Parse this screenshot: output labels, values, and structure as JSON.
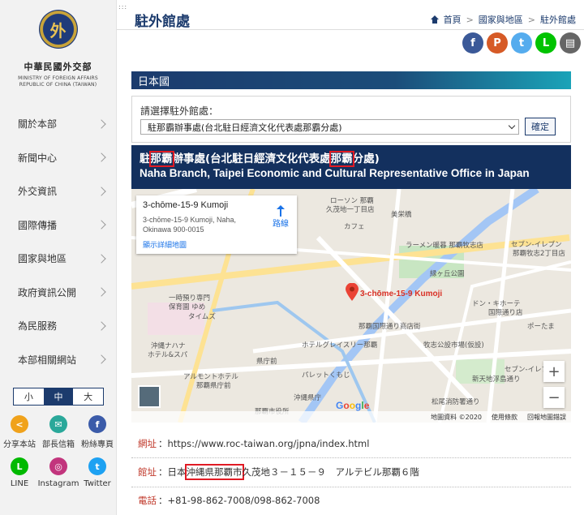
{
  "sidebar": {
    "org_name_cn": "中華民國外交部",
    "org_name_en_1": "MINISTRY OF FOREIGN AFFAIRS",
    "org_name_en_2": "REPUBLIC OF CHINA (TAIWAN)",
    "emblem_text": "外",
    "nav": [
      "關於本部",
      "新聞中心",
      "外交資訊",
      "國際傳播",
      "國家與地區",
      "政府資訊公開",
      "為民服務",
      "本部相關網站"
    ],
    "font_sizes": [
      "小",
      "中",
      "大"
    ],
    "font_size_selected": "中",
    "social": [
      {
        "label": "分享本站",
        "icon": "share-icon",
        "color": "#f0a21b",
        "glyph": "<"
      },
      {
        "label": "部長信箱",
        "icon": "mail-icon",
        "color": "#2aa89a",
        "glyph": "✉"
      },
      {
        "label": "粉絲專頁",
        "icon": "facebook-icon",
        "color": "#3b5ba9",
        "glyph": "f"
      },
      {
        "label": "LINE",
        "icon": "line-icon",
        "color": "#00b900",
        "glyph": "L"
      },
      {
        "label": "Instagram",
        "icon": "instagram-icon",
        "color": "#c2357d",
        "glyph": "◎"
      },
      {
        "label": "Twitter",
        "icon": "twitter-icon",
        "color": "#1da1f2",
        "glyph": "t"
      }
    ]
  },
  "header": {
    "title": "駐外館處",
    "breadcrumb": [
      "首頁",
      "國家與地區",
      "駐外館處"
    ],
    "share_buttons": [
      {
        "icon": "facebook-icon",
        "color": "#3b5998",
        "glyph": "f"
      },
      {
        "icon": "plurk-icon",
        "color": "#d65a26",
        "glyph": "P"
      },
      {
        "icon": "twitter-icon",
        "color": "#55acee",
        "glyph": "t"
      },
      {
        "icon": "line-icon",
        "color": "#00c300",
        "glyph": "L"
      },
      {
        "icon": "print-icon",
        "color": "#666666",
        "glyph": "▤"
      }
    ]
  },
  "country": "日本國",
  "selector": {
    "label": "請選擇駐外館處：",
    "value": "駐那霸辦事處(台北駐日經濟文化代表處那霸分處)",
    "button": "確定"
  },
  "office": {
    "cn_a": "駐",
    "cn_hl1": "那霸",
    "cn_b": "辦事處(台北駐日經濟文化代表處",
    "cn_hl2": "那霸",
    "cn_c": "分處)",
    "en": "Naha Branch, Taipei Economic and Cultural Representative Office in Japan"
  },
  "map": {
    "card_title": "3-chōme-15-9 Kumoji",
    "card_address": "3-chōme-15-9 Kumoji, Naha, Okinawa 900-0015",
    "directions": "路線",
    "bigger_map": "顯示詳細地圖",
    "pin_label": "3-chōme-15-9 Kumoji",
    "footer": [
      "地圖資料 ©2020",
      "使用條款",
      "回報地圖錯誤"
    ],
    "google": "Google",
    "places": [
      "ローソン 那覇",
      "久茂地一丁目店",
      "美栄橋",
      "ラーメン暖暮 那覇牧志店",
      "セブン-イレブン",
      "那覇牧志2丁目店",
      "縁ヶ丘公園",
      "一時預り専門",
      "保育園 ゆめ",
      "タイムズ",
      "沖縄ナハナ",
      "ホテル&スパ",
      "アルモントホテル",
      "那覇県庁前",
      "県庁前",
      "沖縄県庁",
      "那覇市役所",
      "那覇国際通り商店街",
      "牧志公設市場(仮設)",
      "ドン・キホーテ",
      "国際通り店",
      "松尾消防署通り",
      "新天地浮島通り",
      "パレットくもじ",
      "ホテルグレイスリー那覇",
      "カフェ",
      "セブン-イレブン",
      "ポーたま"
    ]
  },
  "info": {
    "site_label": "網址",
    "site": "https://www.roc-taiwan.org/jpna/index.html",
    "addr_label": "館址",
    "addr_a": "日本",
    "addr_hl": "沖縄県那覇市",
    "addr_b": "久茂地３－１５－９　アルテビル那覇６階",
    "tel_label": "電話",
    "tel": "+81-98-862-7008/098-862-7008"
  }
}
